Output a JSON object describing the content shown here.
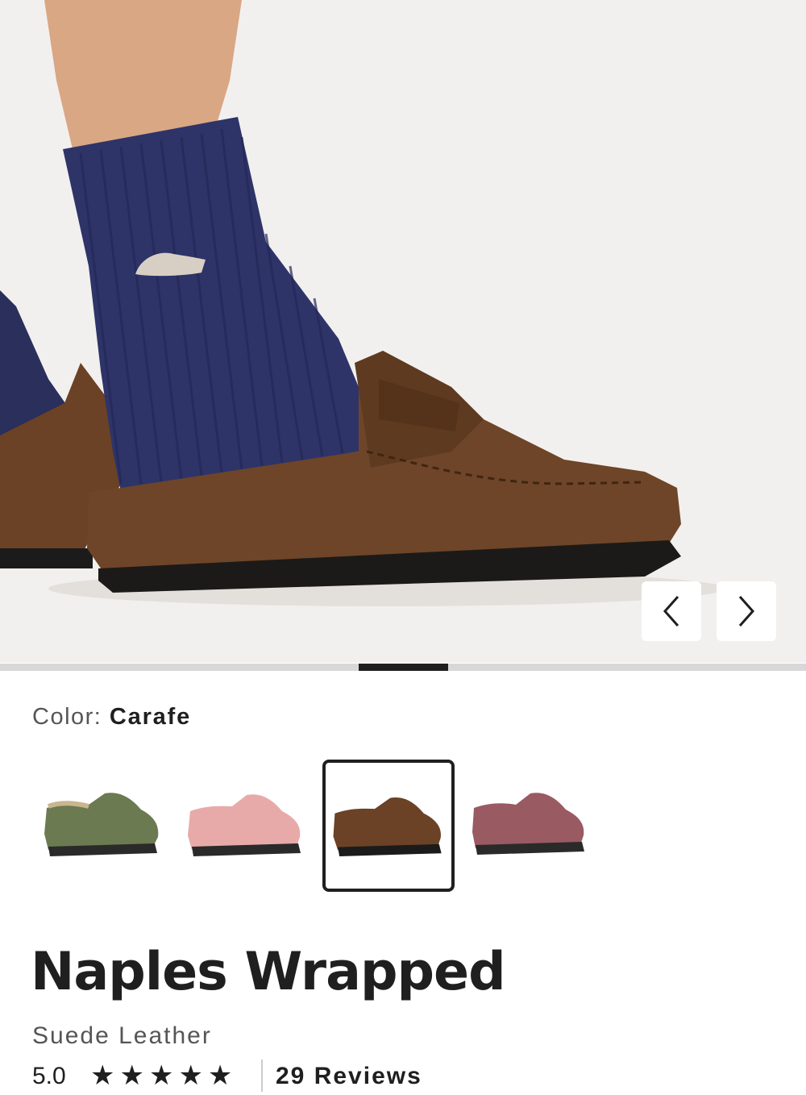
{
  "hero": {
    "image_alt": "Model wearing brown suede clog loafer with navy ribbed sock",
    "prev_icon": "chevron-left-icon",
    "next_icon": "chevron-right-icon",
    "slide_progress": 0.5
  },
  "color": {
    "label": "Color:",
    "selected": "Carafe"
  },
  "swatches": [
    {
      "name": "Olive",
      "color": "#6b7a50",
      "selected": false
    },
    {
      "name": "Pink",
      "color": "#e8aaa8",
      "selected": false
    },
    {
      "name": "Carafe",
      "color": "#6b4226",
      "selected": true
    },
    {
      "name": "Mauve",
      "color": "#9a5a62",
      "selected": false
    }
  ],
  "product": {
    "title": "Naples Wrapped",
    "material": "Suede Leather",
    "rating": "5.0",
    "stars": "★★★★★",
    "reviews": "29 Reviews"
  }
}
